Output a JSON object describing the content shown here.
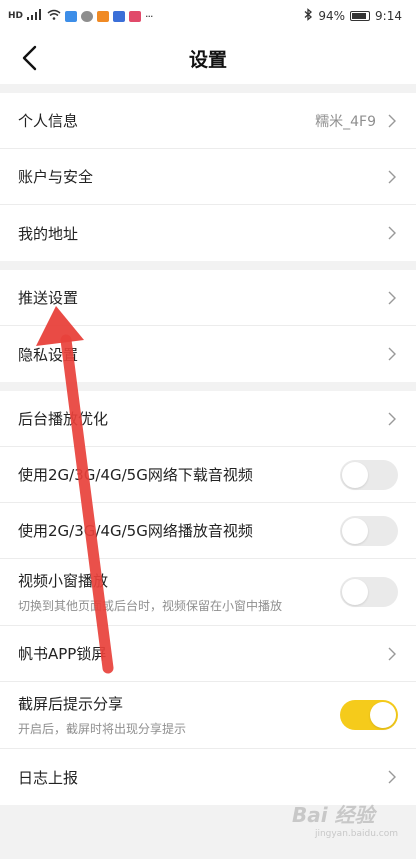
{
  "status_bar": {
    "left_text": "HD",
    "battery": "94%",
    "time": "9:14"
  },
  "nav": {
    "title": "设置"
  },
  "groups": [
    {
      "items": [
        {
          "label": "个人信息",
          "value": "糯米_4F9"
        },
        {
          "label": "账户与安全"
        },
        {
          "label": "我的地址"
        }
      ]
    },
    {
      "items": [
        {
          "label": "推送设置"
        },
        {
          "label": "隐私设置"
        }
      ]
    },
    {
      "items": [
        {
          "label": "后台播放优化"
        },
        {
          "label": "使用2G/3G/4G/5G网络下载音视频",
          "toggle": false
        },
        {
          "label": "使用2G/3G/4G/5G网络播放音视频",
          "toggle": false
        },
        {
          "label": "视频小窗播放",
          "sub": "切换到其他页面或后台时，视频保留在小窗中播放",
          "toggle": false
        },
        {
          "label": "帆书APP锁屏"
        },
        {
          "label": "截屏后提示分享",
          "sub": "开启后，截屏时将出现分享提示",
          "toggle": true
        },
        {
          "label": "日志上报"
        }
      ]
    }
  ],
  "watermark": {
    "main": "Bai 经验",
    "sub": "jingyan.baidu.com"
  },
  "colors": {
    "toggle_on": "#f5cb1b",
    "arrow": "#e8413b"
  }
}
